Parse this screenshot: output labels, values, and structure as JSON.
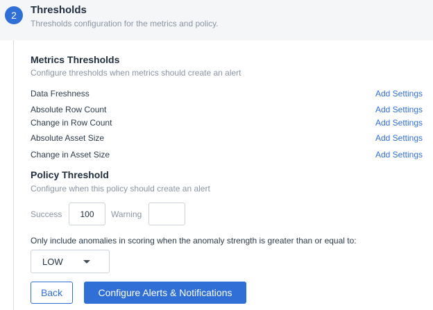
{
  "step": {
    "number": "2",
    "title": "Thresholds",
    "subtitle": "Thresholds configuration for the metrics and policy."
  },
  "metrics_section": {
    "title": "Metrics Thresholds",
    "description": "Configure thresholds when metrics should create an alert",
    "items": [
      {
        "label": "Data Freshness",
        "action": "Add Settings"
      },
      {
        "label": "Absolute Row Count",
        "action": "Add Settings"
      },
      {
        "label": "Change in Row Count",
        "action": "Add Settings"
      },
      {
        "label": "Absolute Asset Size",
        "action": "Add Settings"
      },
      {
        "label": "Change in Asset Size",
        "action": "Add Settings"
      }
    ]
  },
  "policy_section": {
    "title": "Policy Threshold",
    "description": "Configure when this policy should create an alert",
    "success_label": "Success",
    "success_value": "100",
    "warning_label": "Warning",
    "warning_value": ""
  },
  "anomaly": {
    "note": "Only include anomalies in scoring when the anomaly strength is greater than or equal to:",
    "selected": "LOW"
  },
  "actions": {
    "back_label": "Back",
    "configure_label": "Configure Alerts & Notifications"
  },
  "colors": {
    "accent": "#2f6fd6",
    "muted_text": "#8a94a3",
    "header_bg": "#f5f6f8"
  }
}
